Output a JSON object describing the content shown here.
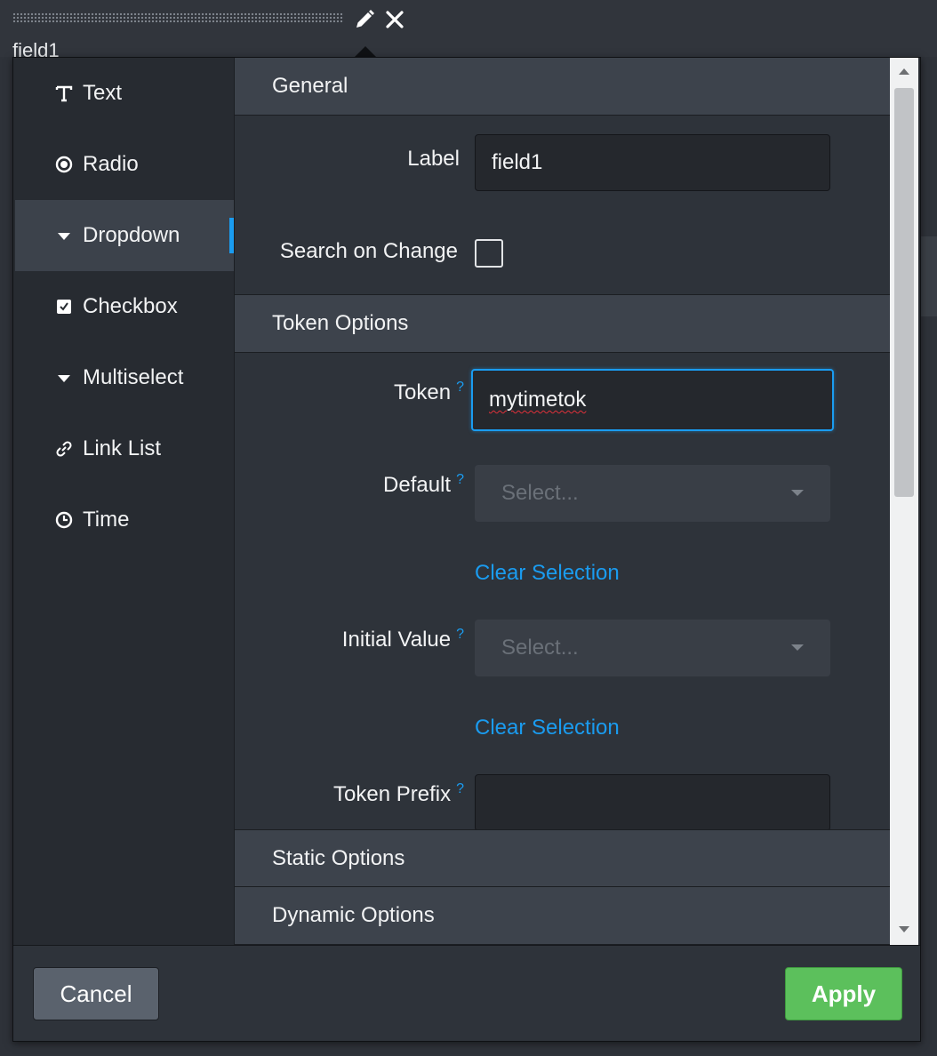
{
  "header": {
    "field_title": "field1",
    "edit_icon": "pencil-icon",
    "close_icon": "close-icon"
  },
  "input_types": [
    {
      "label": "Text",
      "icon": "text-icon",
      "active": false
    },
    {
      "label": "Radio",
      "icon": "radio-icon",
      "active": false
    },
    {
      "label": "Dropdown",
      "icon": "caret-down-icon",
      "active": true
    },
    {
      "label": "Checkbox",
      "icon": "checkbox-icon",
      "active": false
    },
    {
      "label": "Multiselect",
      "icon": "caret-down-icon",
      "active": false
    },
    {
      "label": "Link List",
      "icon": "link-icon",
      "active": false
    },
    {
      "label": "Time",
      "icon": "clock-icon",
      "active": false
    }
  ],
  "general": {
    "header": "General",
    "label_label": "Label",
    "label_value": "field1",
    "search_on_change_label": "Search on Change",
    "search_on_change_checked": false
  },
  "token_options": {
    "header": "Token Options",
    "token_label": "Token",
    "token_value": "mytimetok",
    "default_label": "Default",
    "default_placeholder": "Select...",
    "clear_selection_1": "Clear Selection",
    "initial_value_label": "Initial Value",
    "initial_value_placeholder": "Select...",
    "clear_selection_2": "Clear Selection",
    "token_prefix_label": "Token Prefix",
    "token_prefix_value": "",
    "help_mark": "?"
  },
  "static_options": {
    "header": "Static Options"
  },
  "dynamic_options": {
    "header": "Dynamic Options"
  },
  "footer": {
    "cancel_label": "Cancel",
    "apply_label": "Apply"
  },
  "colors": {
    "accent": "#1a9cf0",
    "apply_green": "#5cc05c",
    "panel_bg": "#2e333a",
    "section_header_bg": "#3d434c"
  }
}
